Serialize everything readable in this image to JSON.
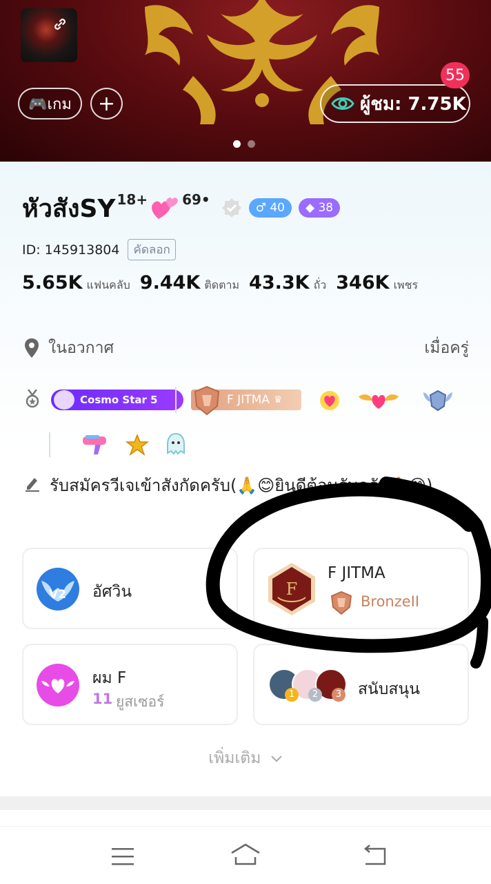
{
  "header": {
    "game_chip_label": "🎮เกม",
    "add_label": "+",
    "viewers_label": "ผู้ชม: 7.75K",
    "notification_count": "55",
    "carousel_pages": 2,
    "carousel_active": 1
  },
  "profile": {
    "name": "หัวสังSY",
    "name_suffix_1": "18+",
    "name_suffix_2": "69•",
    "male_badge": "♂ 40",
    "diamond_badge": "◆ 38",
    "id_text": "ID: 145913804",
    "copy_label": "คัดลอก",
    "stats": [
      {
        "value": "5.65K",
        "label": "แฟนคลับ"
      },
      {
        "value": "9.44K",
        "label": "ติดตาม"
      },
      {
        "value": "43.3K",
        "label": "ถั่ว"
      },
      {
        "value": "346K",
        "label": "เพชร"
      }
    ],
    "location": "ในอวกาศ",
    "zodiac": "เมื่อครู่",
    "cosmo_badge": "Cosmo Star 5",
    "family_badge": "F JITMA",
    "bio": "รับสมัครวีเจเข้าสังกัดครับ(🙏😊ยินดีต้อนรับครับ🙏😊)"
  },
  "cards": {
    "guardian_name": "อัศวิน",
    "guardian_badge": "V2",
    "family_name": "F JITMA",
    "family_rank": "BronzeII",
    "fan_name": "ผม F",
    "fan_count": "11",
    "fan_count_label": "ยูสเซอร์",
    "support_label": "สนับสนุน",
    "support_ranks": [
      "1",
      "2",
      "3"
    ]
  },
  "more_label": "เพิ่มเติม",
  "nav": {
    "menu": "menu-icon",
    "home": "home-icon",
    "back": "back-icon"
  },
  "colors": {
    "banner_red": "#5c0c10",
    "ornament_gold": "#d9a82a",
    "notif_pink": "#f0305a",
    "teal_eye": "#3ad1b8",
    "cosmo_purple": "#7a2dff",
    "bronze": "#c8825e",
    "fan_pink": "#e84ce6"
  }
}
